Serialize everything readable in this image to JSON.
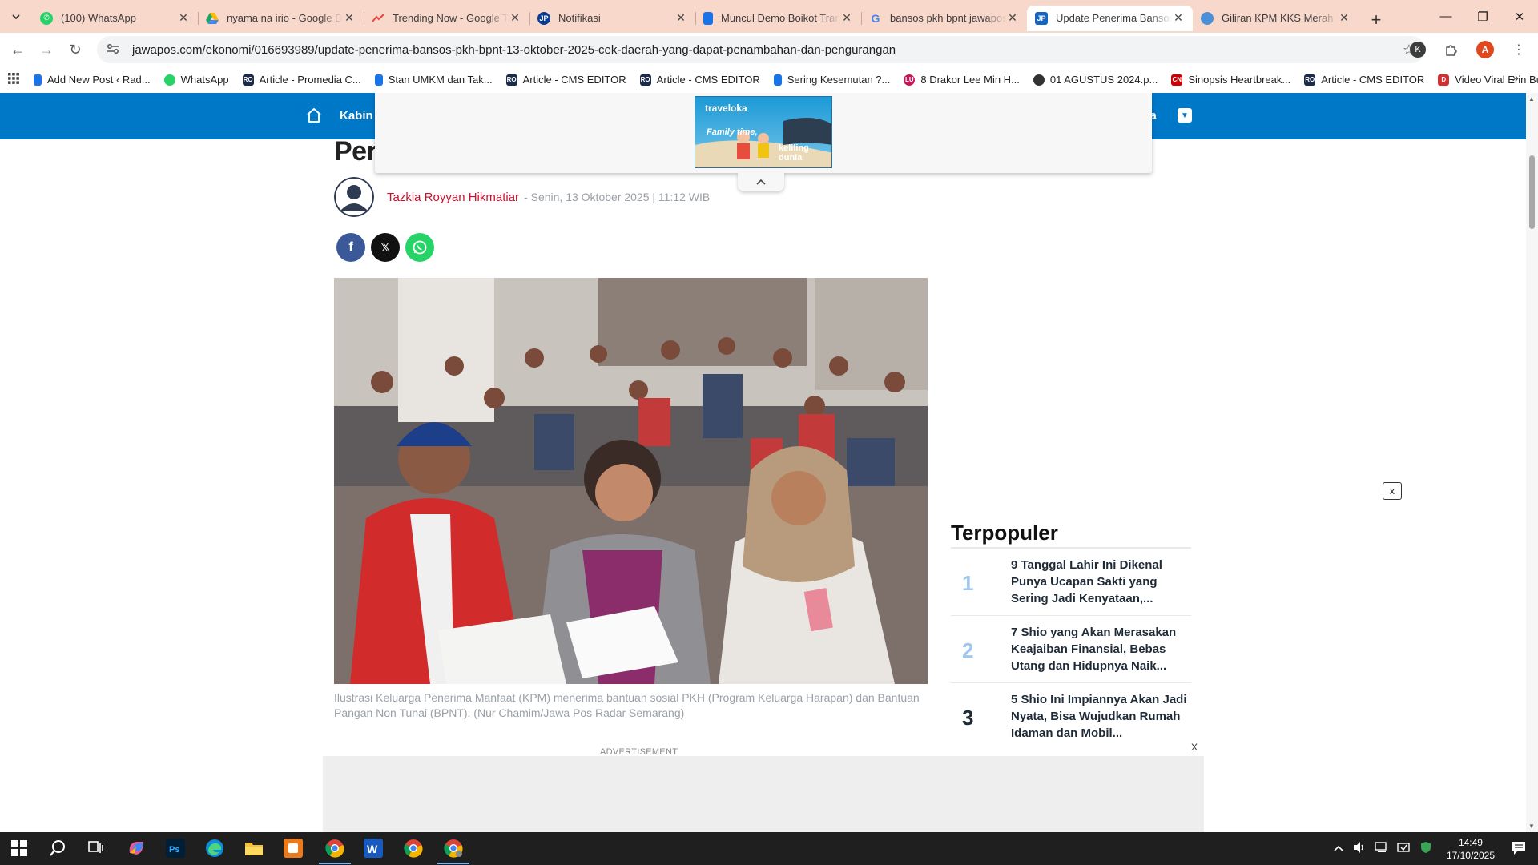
{
  "browser": {
    "tabs": [
      {
        "title": "(100) WhatsApp",
        "favicon": "whatsapp-icon",
        "color": "#25d366",
        "active": false
      },
      {
        "title": "nyama na irio - Google Drive",
        "favicon": "google-drive-icon",
        "color": "#1fa463",
        "active": false
      },
      {
        "title": "Trending Now - Google Trends",
        "favicon": "trends-icon",
        "color": "#e8453c",
        "active": false
      },
      {
        "title": "Notifikasi",
        "favicon": "jp-icon",
        "color": "#0a3d91",
        "active": false
      },
      {
        "title": "Muncul Demo Boikot Tran",
        "favicon": "doc-icon",
        "color": "#1a73e8",
        "active": false
      },
      {
        "title": "bansos pkh bpnt jawapos",
        "favicon": "google-icon",
        "color": "#4285f4",
        "active": false
      },
      {
        "title": "Update Penerima Bansos",
        "favicon": "jp-icon",
        "color": "#1565c0",
        "active": true
      },
      {
        "title": "Giliran KPM KKS Merah P",
        "favicon": "globe-icon",
        "color": "#4a90d9",
        "active": false
      }
    ],
    "url": "jawapos.com/ekonomi/016693989/update-penerima-bansos-pkh-bpnt-13-oktober-2025-cek-daerah-yang-dapat-penambahan-dan-pengurangan",
    "profile_initial_k": "K",
    "profile_initial_a": "A",
    "bookmarks": [
      {
        "label": "Add New Post ‹ Rad...",
        "color": "#1a73e8"
      },
      {
        "label": "WhatsApp",
        "color": "#25d366"
      },
      {
        "label": "Article - Promedia C...",
        "color": "#1b2a49"
      },
      {
        "label": "Stan UMKM dan Tak...",
        "color": "#1a73e8"
      },
      {
        "label": "Article - CMS EDITOR",
        "color": "#1b2a49"
      },
      {
        "label": "Article - CMS EDITOR",
        "color": "#1b2a49"
      },
      {
        "label": "Sering Kesemutan ?...",
        "color": "#1a73e8"
      },
      {
        "label": "8 Drakor Lee Min H...",
        "color": "#c2185b"
      },
      {
        "label": "01 AGUSTUS 2024.p...",
        "color": "#333333"
      },
      {
        "label": "Sinopsis Heartbreak...",
        "color": "#cc0000"
      },
      {
        "label": "Article - CMS EDITOR",
        "color": "#1b2a49"
      },
      {
        "label": "Video Viral Erin Bug...",
        "color": "#d32f2f"
      }
    ]
  },
  "page": {
    "nav_first": "Kabin",
    "nav_last": "nya",
    "headline": "Per",
    "ad_banner": {
      "brand": "traveloka",
      "line1": "Family time,",
      "line2": "keliling dunia"
    },
    "author": "Tazkia Royyan Hikmatiar",
    "date": "- Senin, 13 Oktober 2025 | 11:12 WIB",
    "caption": "Ilustrasi Keluarga Penerima Manfaat (KPM) menerima bantuan sosial PKH (Program Keluarga Harapan) dan Bantuan Pangan Non Tunai (BPNT). (Nur Chamim/Jawa Pos Radar Semarang)",
    "ad_label": "ADVERTISEMENT",
    "close_x": "x",
    "close_X": "X",
    "popular": {
      "title": "Terpopuler",
      "items": [
        {
          "num": "1",
          "text": "9 Tanggal Lahir Ini Dikenal Punya Ucapan Sakti yang Sering Jadi Kenyataan,...",
          "color": "#9fc7ef"
        },
        {
          "num": "2",
          "text": "7 Shio yang Akan Merasakan Keajaiban Finansial, Bebas Utang dan Hidupnya Naik...",
          "color": "#9fc7ef"
        },
        {
          "num": "3",
          "text": "5 Shio Ini Impiannya Akan Jadi Nyata, Bisa Wujudkan Rumah Idaman dan Mobil...",
          "color": "#1f2a37"
        }
      ]
    }
  },
  "taskbar": {
    "time": "14:49",
    "date": "17/10/2025"
  },
  "colors": {
    "site_blue": "#0078c8",
    "author_red": "#c8102e",
    "tabstrip": "#f9d8cc"
  }
}
